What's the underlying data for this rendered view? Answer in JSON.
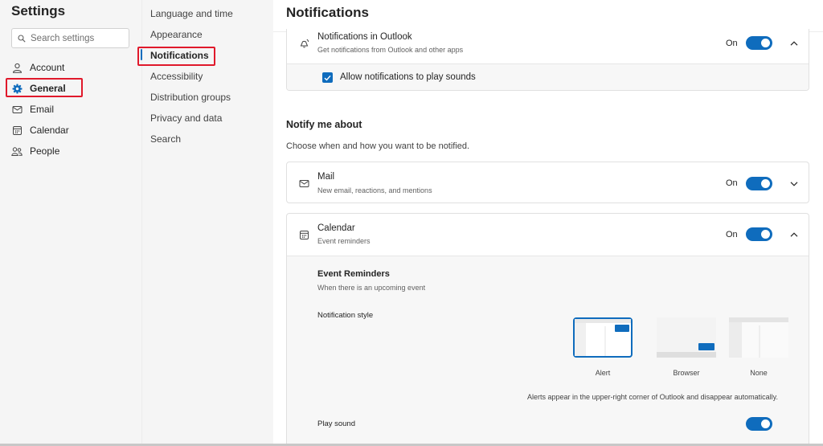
{
  "sidebar": {
    "title": "Settings",
    "search_placeholder": "Search settings",
    "items": [
      {
        "label": "Account",
        "icon": "person-icon"
      },
      {
        "label": "General",
        "icon": "gear-icon"
      },
      {
        "label": "Email",
        "icon": "mail-icon"
      },
      {
        "label": "Calendar",
        "icon": "calendar-icon"
      },
      {
        "label": "People",
        "icon": "people-icon"
      }
    ]
  },
  "subnav": {
    "items": [
      {
        "label": "Language and time"
      },
      {
        "label": "Appearance"
      },
      {
        "label": "Notifications"
      },
      {
        "label": "Accessibility"
      },
      {
        "label": "Distribution groups"
      },
      {
        "label": "Privacy and data"
      },
      {
        "label": "Search"
      }
    ]
  },
  "main": {
    "title": "Notifications",
    "outlook_card": {
      "title": "Notifications in Outlook",
      "subtitle": "Get notifications from Outlook and other apps",
      "state": "On",
      "checkbox_label": "Allow notifications to play sounds"
    },
    "notify_section": {
      "title": "Notify me about",
      "subtitle": "Choose when and how you want to be notified."
    },
    "mail_card": {
      "title": "Mail",
      "subtitle": "New email, reactions, and mentions",
      "state": "On"
    },
    "calendar_card": {
      "title": "Calendar",
      "subtitle": "Event reminders",
      "state": "On",
      "reminders_title": "Event Reminders",
      "reminders_subtitle": "When there is an upcoming event",
      "style_label": "Notification style",
      "styles": [
        {
          "label": "Alert",
          "selected": true
        },
        {
          "label": "Browser",
          "selected": false
        },
        {
          "label": "None",
          "selected": false
        }
      ],
      "alerts_note": "Alerts appear in the upper-right corner of Outlook and disappear automatically.",
      "play_sound_label": "Play sound"
    }
  },
  "colors": {
    "accent": "#0f6cbd",
    "highlight_box": "#e0192b"
  }
}
